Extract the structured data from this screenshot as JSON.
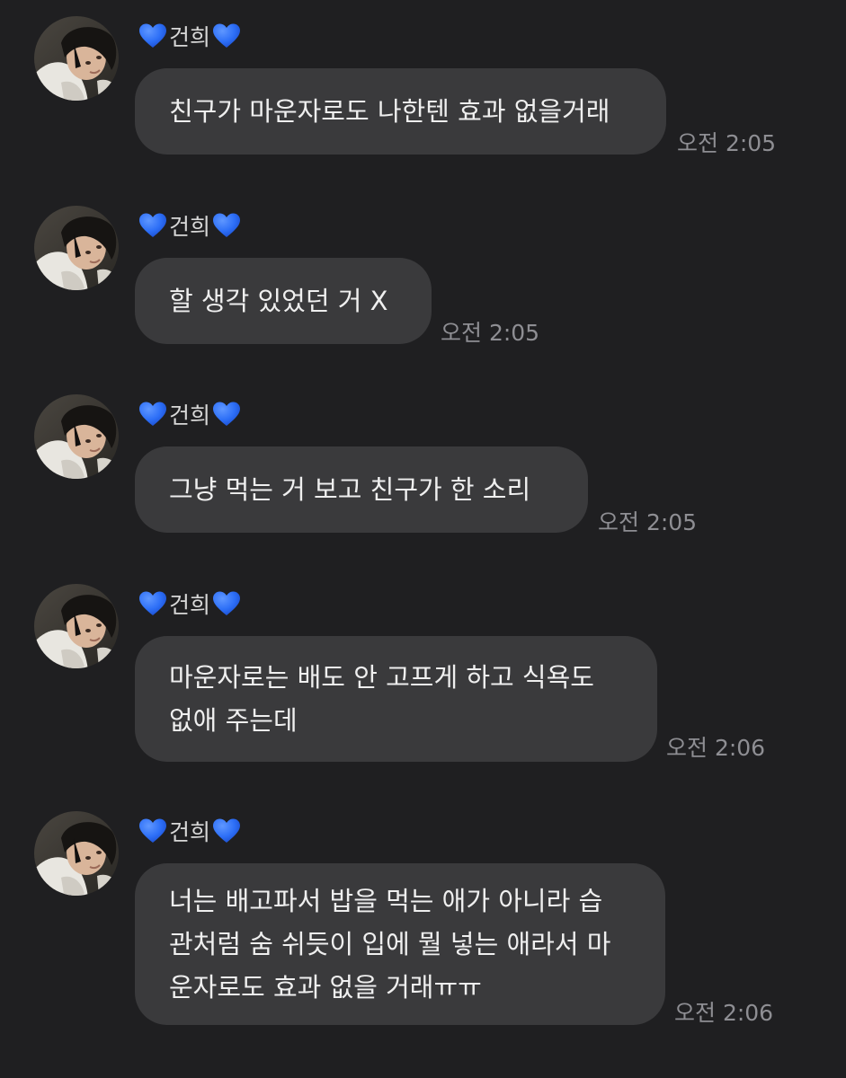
{
  "sender": {
    "name": "건희",
    "heart_color": "#2d6ff7"
  },
  "messages": [
    {
      "lines": [
        "친구가 마운자로도 나한텐 효과 없을거래"
      ],
      "time": "오전 2:05"
    },
    {
      "lines": [
        "할 생각 있었던 거 X"
      ],
      "time": "오전 2:05"
    },
    {
      "lines": [
        "그냥 먹는 거 보고 친구가 한 소리"
      ],
      "time": "오전 2:05"
    },
    {
      "lines": [
        "마운자로는 배도 안 고프게 하고 식욕도",
        "없애 주는데"
      ],
      "time": "오전 2:06"
    },
    {
      "lines": [
        "너는 배고파서 밥을 먹는 애가 아니라 습",
        "관처럼 숨 쉬듯이 입에 뭘 넣는 애라서 마",
        "운자로도 효과 없을 거래ㅠㅠ"
      ],
      "time": "오전 2:06"
    }
  ]
}
